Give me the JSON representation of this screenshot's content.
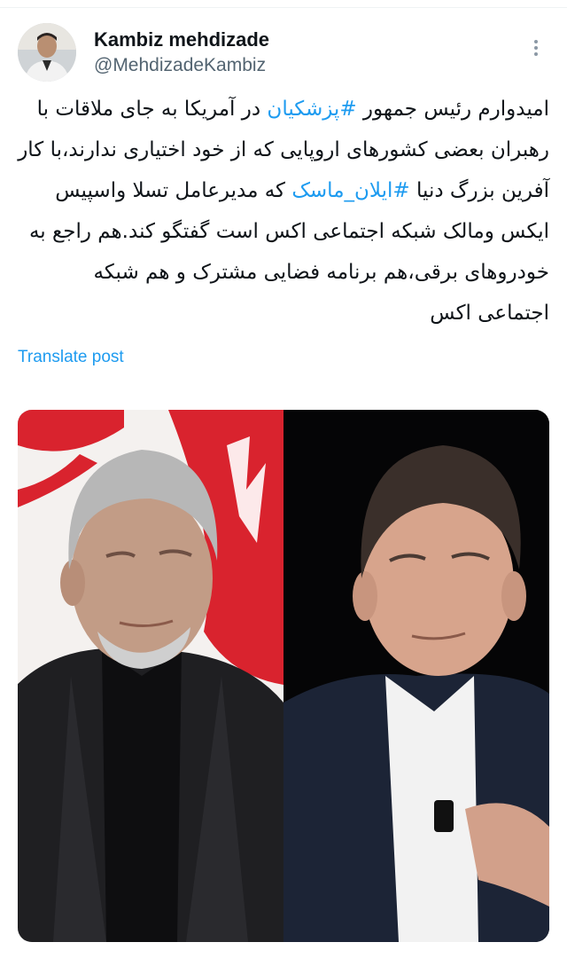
{
  "tweet": {
    "display_name": "Kambiz mehdizade",
    "handle": "@MehdizadeKambiz",
    "text_parts": [
      "امیدوارم رئیس جمهور ",
      "#پزشکیان",
      " در آمریکا به جای ملاقات با رهبران بعضی کشورهای اروپایی که از خود اختیاری ندارند،با کار آفرین بزرگ دنیا ",
      "#ایلان_ماسک",
      " که مدیرعامل تسلا واسپیس ایکس ومالک شبکه اجتماعی اکس است گفتگو کند.هم راجع به خودروهای برقی،هم برنامه فضایی مشترک و هم شبکه اجتماعی اکس"
    ],
    "translate_label": "Translate post"
  },
  "icons": {
    "more": "more-vertical-icon"
  },
  "colors": {
    "link": "#1d9bf0",
    "secondary_text": "#536471",
    "primary_text": "#0f1419",
    "flag_red": "#d9232e",
    "suit_dark": "#1c2436"
  }
}
